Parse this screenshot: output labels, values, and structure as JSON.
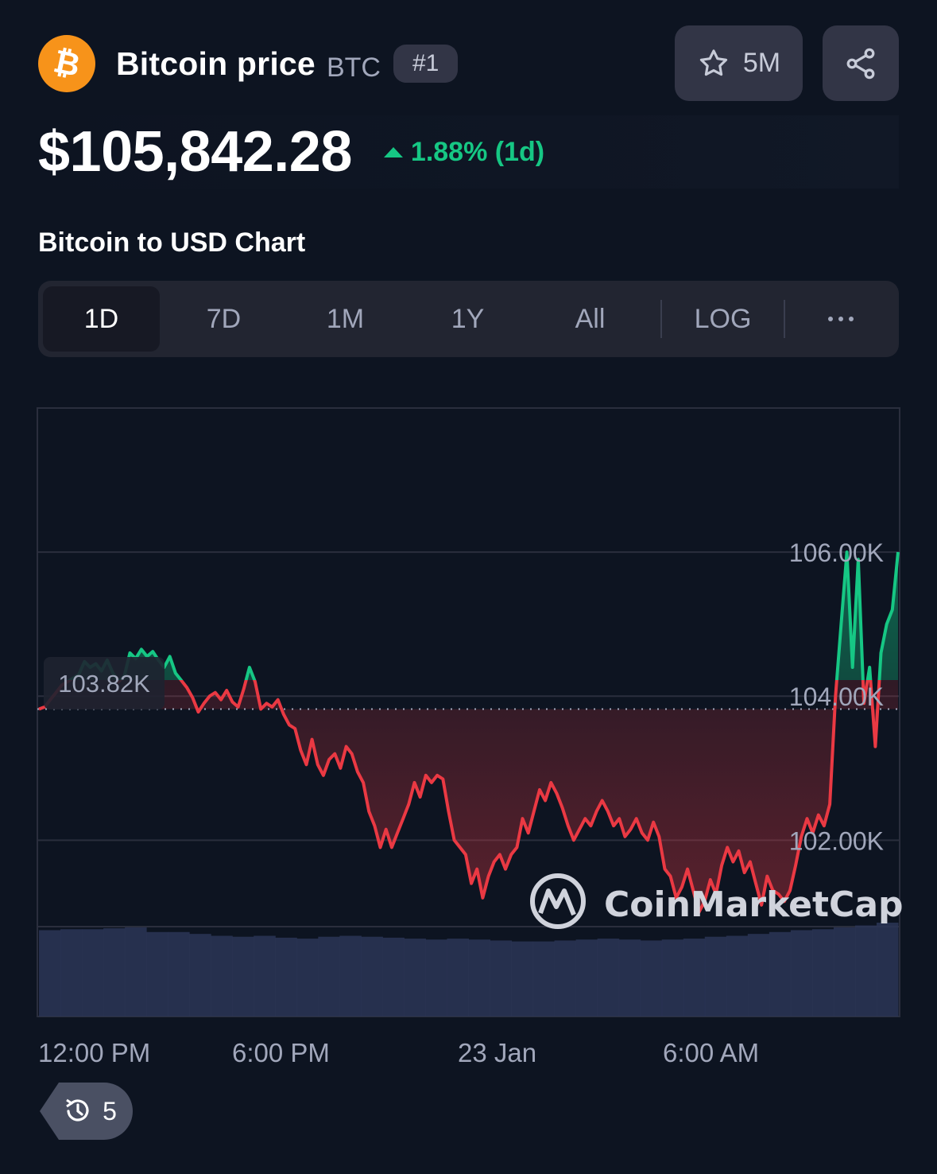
{
  "coin": {
    "name": "Bitcoin price",
    "symbol": "BTC",
    "rank": "#1",
    "logo_icon": "bitcoin-logo-icon",
    "logo_color": "#f7931a",
    "logo_glyph": "₿"
  },
  "watchlist": {
    "count": "5M",
    "icon": "star-icon"
  },
  "share": {
    "icon": "share-icon"
  },
  "price": {
    "value": "$105,842.28",
    "change": "1.88% (1d)",
    "change_color": "#16c784"
  },
  "chart_title": "Bitcoin to USD Chart",
  "ranges": {
    "tabs": [
      "1D",
      "7D",
      "1M",
      "1Y",
      "All"
    ],
    "active": "1D",
    "log_label": "LOG",
    "more_icon": "more-horizontal-icon"
  },
  "chart_data": {
    "type": "area",
    "series": [
      {
        "values": [
          103.82,
          103.85,
          103.95,
          104.05,
          104.15,
          104.2,
          104.25,
          104.3,
          104.48,
          104.4,
          104.45,
          104.35,
          104.5,
          104.32,
          104.2,
          104.28,
          104.6,
          104.52,
          104.65,
          104.55,
          104.62,
          104.5,
          104.4,
          104.55,
          104.32,
          104.22,
          104.12,
          103.98,
          103.78,
          103.9,
          104.0,
          104.05,
          103.95,
          104.08,
          103.92,
          103.85,
          104.1,
          104.4,
          104.2,
          103.82,
          103.9,
          103.85,
          103.95,
          103.75,
          103.6,
          103.55,
          103.25,
          103.05,
          103.4,
          103.05,
          102.9,
          103.12,
          103.2,
          103.0,
          103.3,
          103.2,
          102.95,
          102.8,
          102.4,
          102.2,
          101.9,
          102.15,
          101.9,
          102.1,
          102.3,
          102.5,
          102.8,
          102.6,
          102.9,
          102.8,
          102.9,
          102.85,
          102.4,
          102.0,
          101.9,
          101.8,
          101.4,
          101.6,
          101.2,
          101.5,
          101.7,
          101.8,
          101.6,
          101.8,
          101.9,
          102.3,
          102.1,
          102.4,
          102.7,
          102.55,
          102.8,
          102.65,
          102.45,
          102.2,
          102.0,
          102.15,
          102.3,
          102.2,
          102.4,
          102.55,
          102.4,
          102.2,
          102.3,
          102.05,
          102.15,
          102.3,
          102.1,
          102.0,
          102.25,
          102.05,
          101.6,
          101.5,
          101.2,
          101.35,
          101.6,
          101.3,
          101.0,
          101.15,
          101.45,
          101.25,
          101.65,
          101.9,
          101.7,
          101.85,
          101.55,
          101.7,
          101.4,
          101.1,
          101.5,
          101.3,
          101.25,
          101.15,
          101.3,
          101.65,
          102.05,
          102.3,
          102.1,
          102.35,
          102.2,
          102.5,
          104.0,
          105.0,
          106.0,
          104.4,
          105.9,
          103.9,
          104.4,
          103.3,
          104.6,
          105.0,
          105.2,
          106.0
        ]
      }
    ],
    "reference_price": 103.82,
    "reference_label": "103.82K",
    "y_ticks": [
      "106.00K",
      "104.00K",
      "102.00K"
    ],
    "y_tick_values": [
      106,
      104,
      102
    ],
    "ylim": [
      100.8,
      108.0
    ],
    "x_ticks": [
      "12:00 PM",
      "6:00 PM",
      "23 Jan",
      "6:00 AM"
    ],
    "volume": [
      0.92,
      0.93,
      0.93,
      0.94,
      0.95,
      0.9,
      0.9,
      0.88,
      0.86,
      0.85,
      0.86,
      0.84,
      0.83,
      0.85,
      0.86,
      0.85,
      0.84,
      0.83,
      0.82,
      0.83,
      0.82,
      0.81,
      0.8,
      0.8,
      0.81,
      0.82,
      0.83,
      0.82,
      0.81,
      0.82,
      0.83,
      0.85,
      0.86,
      0.88,
      0.9,
      0.92,
      0.93,
      0.95,
      0.97,
      1.0
    ],
    "up_color": "#16c784",
    "down_color": "#ea3943",
    "grid": true,
    "watermark": "CoinMarketCap"
  },
  "history": {
    "count": "5",
    "icon": "history-clock-icon"
  }
}
